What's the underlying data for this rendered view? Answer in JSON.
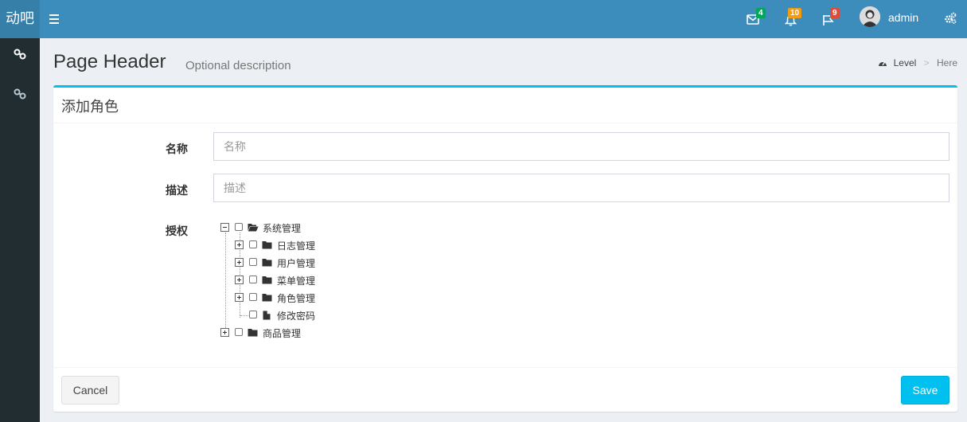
{
  "app": {
    "logo_text": "动吧"
  },
  "navbar": {
    "messages_badge": "4",
    "notifications_badge": "10",
    "tasks_badge": "9",
    "username": "admin",
    "colors": {
      "bar": "#3c8dbc",
      "badge_green": "#00a65a",
      "badge_yellow": "#f39c12",
      "badge_red": "#dd4b39"
    }
  },
  "sidebar": {
    "items": [
      {
        "icon": "link-icon"
      },
      {
        "icon": "link-icon"
      }
    ]
  },
  "header": {
    "title": "Page Header",
    "description": "Optional description",
    "breadcrumb": {
      "level": "Level",
      "here": "Here"
    }
  },
  "form": {
    "box_title": "添加角色",
    "name_label": "名称",
    "name_placeholder": "名称",
    "name_value": "",
    "desc_label": "描述",
    "desc_placeholder": "描述",
    "desc_value": "",
    "auth_label": "授权",
    "tree": {
      "root": "系统管理",
      "children": [
        "日志管理",
        "用户管理",
        "菜单管理",
        "角色管理",
        "修改密码"
      ],
      "sibling": "商品管理"
    },
    "cancel_label": "Cancel",
    "save_label": "Save",
    "accent": "#00c0ef"
  }
}
